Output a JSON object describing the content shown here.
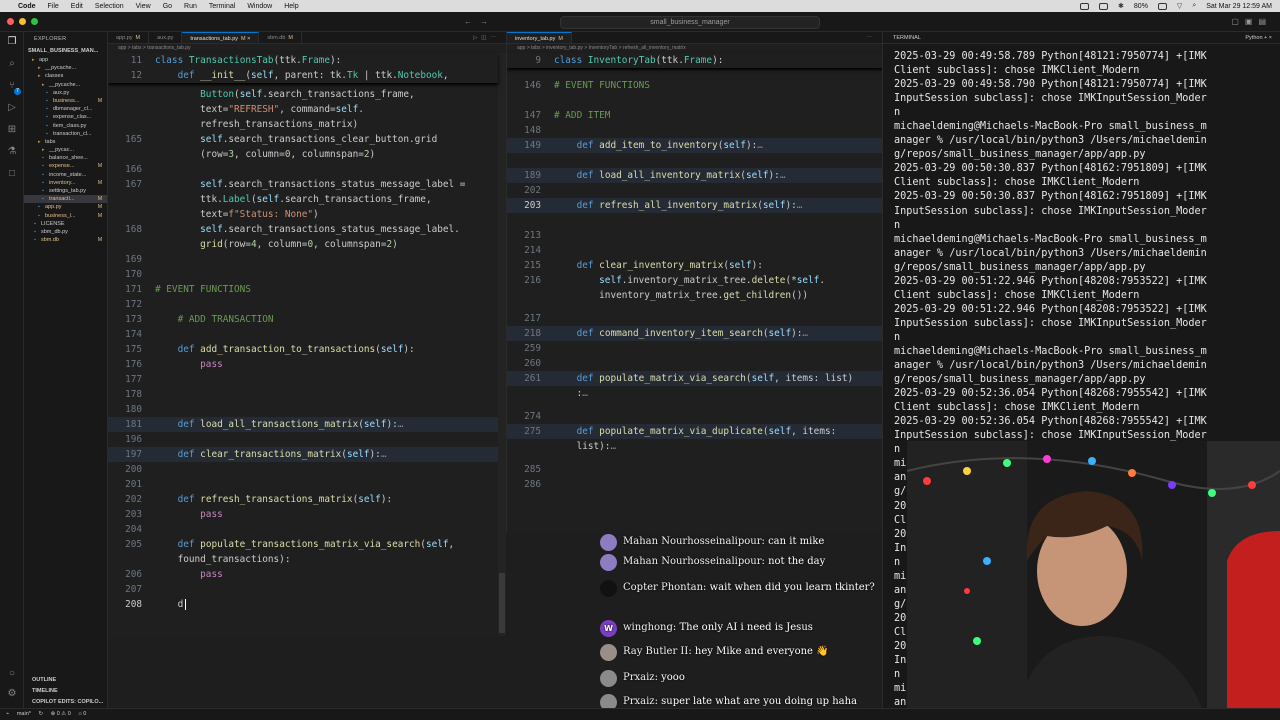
{
  "menubar": {
    "apple": "",
    "items": [
      "Code",
      "File",
      "Edit",
      "Selection",
      "View",
      "Go",
      "Run",
      "Terminal",
      "Window",
      "Help"
    ],
    "battery": "80%",
    "datetime": "Sat Mar 29 12:59 AM"
  },
  "titlebar": {
    "title": "small_business_manager"
  },
  "sidebar": {
    "header": "EXPLORER",
    "project": "SMALL_BUSINESS_MAN...",
    "items": [
      {
        "label": "app",
        "badge": ""
      },
      {
        "label": "__pycache...",
        "badge": ""
      },
      {
        "label": "classes",
        "badge": ""
      },
      {
        "label": "__pycache...",
        "badge": ""
      },
      {
        "label": "aux.py",
        "badge": ""
      },
      {
        "label": "business...",
        "badge": "M"
      },
      {
        "label": "dbmanager_cl...",
        "badge": ""
      },
      {
        "label": "expense_clas...",
        "badge": ""
      },
      {
        "label": "item_class.py",
        "badge": ""
      },
      {
        "label": "transaction_cl...",
        "badge": ""
      },
      {
        "label": "tabs",
        "badge": ""
      },
      {
        "label": "__pycac...",
        "badge": ""
      },
      {
        "label": "balance_shee...",
        "badge": ""
      },
      {
        "label": "expense...",
        "badge": "M"
      },
      {
        "label": "income_state...",
        "badge": ""
      },
      {
        "label": "inventory...",
        "badge": "M"
      },
      {
        "label": "settings_tab.py",
        "badge": ""
      },
      {
        "label": "transacti...",
        "badge": "M"
      },
      {
        "label": "app.py",
        "badge": "M"
      },
      {
        "label": "business_l...",
        "badge": "M"
      },
      {
        "label": "LICENSE",
        "badge": ""
      },
      {
        "label": "sbm_db.py",
        "badge": ""
      },
      {
        "label": "sbm.db",
        "badge": "M"
      }
    ],
    "bottom": [
      "OUTLINE",
      "TIMELINE",
      "COPILOT EDITS: COPILO..."
    ]
  },
  "editor1": {
    "tabs": [
      {
        "label": "app.py",
        "badge": "M",
        "active": false
      },
      {
        "label": "aux.py",
        "badge": "",
        "active": false
      },
      {
        "label": "transactions_tab.py",
        "badge": "M",
        "active": true
      },
      {
        "label": "sbm.db",
        "badge": "M",
        "active": false
      }
    ],
    "breadcrumb": "app > tabs > transactions_tab.py",
    "sticky": [
      {
        "ln": "11",
        "text": "class TransactionsTab(ttk.Frame):"
      },
      {
        "ln": "12",
        "text": "    def __init__(self, parent: tk.Tk | ttk.Notebook,"
      }
    ],
    "lines": [
      {
        "ln": "",
        "text": "        Button(self.search_transactions_frame,"
      },
      {
        "ln": "",
        "text": "        text=\"REFRESH\", command=self."
      },
      {
        "ln": "",
        "text": "        refresh_transactions_matrix)"
      },
      {
        "ln": "165",
        "text": "        self.search_transactions_clear_button.grid"
      },
      {
        "ln": "",
        "text": "        (row=3, column=0, columnspan=2)"
      },
      {
        "ln": "166",
        "text": ""
      },
      {
        "ln": "167",
        "text": "        self.search_transactions_status_message_label ="
      },
      {
        "ln": "",
        "text": "        ttk.Label(self.search_transactions_frame,"
      },
      {
        "ln": "",
        "text": "        text=f\"Status: None\")"
      },
      {
        "ln": "168",
        "text": "        self.search_transactions_status_message_label."
      },
      {
        "ln": "",
        "text": "        grid(row=4, column=0, columnspan=2)"
      },
      {
        "ln": "169",
        "text": ""
      },
      {
        "ln": "170",
        "text": ""
      },
      {
        "ln": "171",
        "text": "# EVENT FUNCTIONS"
      },
      {
        "ln": "172",
        "text": ""
      },
      {
        "ln": "173",
        "text": "    # ADD TRANSACTION"
      },
      {
        "ln": "174",
        "text": ""
      },
      {
        "ln": "175",
        "text": "    def add_transaction_to_transactions(self):"
      },
      {
        "ln": "176",
        "text": "        pass"
      },
      {
        "ln": "177",
        "text": ""
      },
      {
        "ln": "178",
        "text": ""
      },
      {
        "ln": "180",
        "text": ""
      },
      {
        "ln": "181",
        "text": "    def load_all_transactions_matrix(self):…"
      },
      {
        "ln": "196",
        "text": ""
      },
      {
        "ln": "197",
        "text": "    def clear_transactions_matrix(self):…"
      },
      {
        "ln": "200",
        "text": ""
      },
      {
        "ln": "201",
        "text": ""
      },
      {
        "ln": "202",
        "text": "    def refresh_transactions_matrix(self):"
      },
      {
        "ln": "203",
        "text": "        pass"
      },
      {
        "ln": "204",
        "text": ""
      },
      {
        "ln": "205",
        "text": "    def populate_transactions_matrix_via_search(self,"
      },
      {
        "ln": "",
        "text": "    found_transactions):"
      },
      {
        "ln": "206",
        "text": "        pass"
      },
      {
        "ln": "207",
        "text": ""
      },
      {
        "ln": "208",
        "text": "    d"
      }
    ]
  },
  "editor2": {
    "tabs": [
      {
        "label": "inventory_tab.py",
        "badge": "M",
        "active": true
      }
    ],
    "breadcrumb": "app > tabs > inventory_tab.py > InventoryTab > refresh_all_inventory_matrix",
    "sticky": {
      "ln": "9",
      "text": "class InventoryTab(ttk.Frame):"
    },
    "lines": [
      {
        "ln": "146",
        "text": "# EVENT FUNCTIONS"
      },
      {
        "ln": "147",
        "text": "# ADD ITEM"
      },
      {
        "ln": "148",
        "text": ""
      },
      {
        "ln": "149",
        "text": "    def add_item_to_inventory(self):…"
      },
      {
        "ln": "189",
        "text": "    def load_all_inventory_matrix(self):…"
      },
      {
        "ln": "202",
        "text": ""
      },
      {
        "ln": "203",
        "text": "    def refresh_all_inventory_matrix(self):…"
      },
      {
        "ln": "213",
        "text": ""
      },
      {
        "ln": "214",
        "text": ""
      },
      {
        "ln": "215",
        "text": "    def clear_inventory_matrix(self):"
      },
      {
        "ln": "216",
        "text": "        self.inventory_matrix_tree.delete(*self."
      },
      {
        "ln": "",
        "text": "        inventory_matrix_tree.get_children())"
      },
      {
        "ln": "217",
        "text": ""
      },
      {
        "ln": "218",
        "text": "    def command_inventory_item_search(self):…"
      },
      {
        "ln": "259",
        "text": ""
      },
      {
        "ln": "260",
        "text": ""
      },
      {
        "ln": "261",
        "text": "    def populate_matrix_via_search(self, items: list)"
      },
      {
        "ln": "",
        "text": "    :…"
      },
      {
        "ln": "274",
        "text": ""
      },
      {
        "ln": "275",
        "text": "    def populate_matrix_via_duplicate(self, items:"
      },
      {
        "ln": "",
        "text": "    list):…"
      },
      {
        "ln": "285",
        "text": ""
      },
      {
        "ln": "286",
        "text": ""
      }
    ]
  },
  "terminal": {
    "header": "TERMINAL",
    "shell": "Python",
    "lines": [
      "2025-03-29 00:49:58.789 Python[48121:7950774] +[IMK",
      "Client subclass]: chose IMKClient_Modern",
      "2025-03-29 00:49:58.790 Python[48121:7950774] +[IMK",
      "InputSession subclass]: chose IMKInputSession_Moder",
      "n",
      "michaeldeming@Michaels-MacBook-Pro small_business_m",
      "anager % /usr/local/bin/python3 /Users/michaeldemin",
      "g/repos/small_business_manager/app/app.py",
      "2025-03-29 00:50:30.837 Python[48162:7951809] +[IMK",
      "Client subclass]: chose IMKClient_Modern",
      "2025-03-29 00:50:30.837 Python[48162:7951809] +[IMK",
      "InputSession subclass]: chose IMKInputSession_Moder",
      "n",
      "michaeldeming@Michaels-MacBook-Pro small_business_m",
      "anager % /usr/local/bin/python3 /Users/michaeldemin",
      "g/repos/small_business_manager/app/app.py",
      "2025-03-29 00:51:22.946 Python[48208:7953522] +[IMK",
      "Client subclass]: chose IMKClient_Modern",
      "2025-03-29 00:51:22.946 Python[48208:7953522] +[IMK",
      "InputSession subclass]: chose IMKInputSession_Moder",
      "n",
      "michaeldeming@Michaels-MacBook-Pro small_business_m",
      "anager % /usr/local/bin/python3 /Users/michaeldemin",
      "g/repos/small_business_manager/app/app.py",
      "2025-03-29 00:52:36.054 Python[48268:7955542] +[IMK",
      "Client subclass]: chose IMKClient_Modern",
      "2025-03-29 00:52:36.054 Python[48268:7955542] +[IMK",
      "InputSession subclass]: chose IMKInputSession_Moder",
      "n",
      "mi",
      "an",
      "g/",
      "20",
      "Cl",
      "20",
      "In",
      "n",
      "mi",
      "an",
      "g/",
      "20",
      "Cl",
      "20",
      "In",
      "n",
      "mi",
      "an"
    ]
  },
  "chat": [
    {
      "name": "Mahan Nourhosseinalipour",
      "text": "can it mike",
      "color": "#8e7cc3",
      "initial": ""
    },
    {
      "name": "Mahan Nourhosseinalipour",
      "text": "not the day",
      "color": "#8e7cc3",
      "initial": ""
    },
    {
      "name": "Copter Phontan",
      "text": "wait when did you learn tkinter?",
      "color": "#111111",
      "initial": ""
    },
    {
      "name": "winghong",
      "text": "The only AI i need is Jesus",
      "color": "#7b3fc4",
      "initial": "W"
    },
    {
      "name": "Ray Butler II",
      "text": "hey Mike and everyone 👋",
      "color": "#9a8f88",
      "initial": ""
    },
    {
      "name": "Prxaiz",
      "text": "yooo",
      "color": "#8b8b8b",
      "initial": ""
    },
    {
      "name": "Prxaiz",
      "text": "super late what are you doing up haha",
      "color": "#8b8b8b",
      "initial": ""
    }
  ],
  "statusbar": {
    "branch": "main*",
    "sync": "↻",
    "problems": "⊗ 0 ⚠ 0",
    "ports": "⌂ 0"
  },
  "colors": {
    "accent": "#0078d4",
    "modified": "#e2c08d",
    "keyword": "#569cd6",
    "function": "#dcdcaa",
    "class": "#4ec9b0",
    "string": "#ce9178",
    "comment": "#6a9955"
  }
}
